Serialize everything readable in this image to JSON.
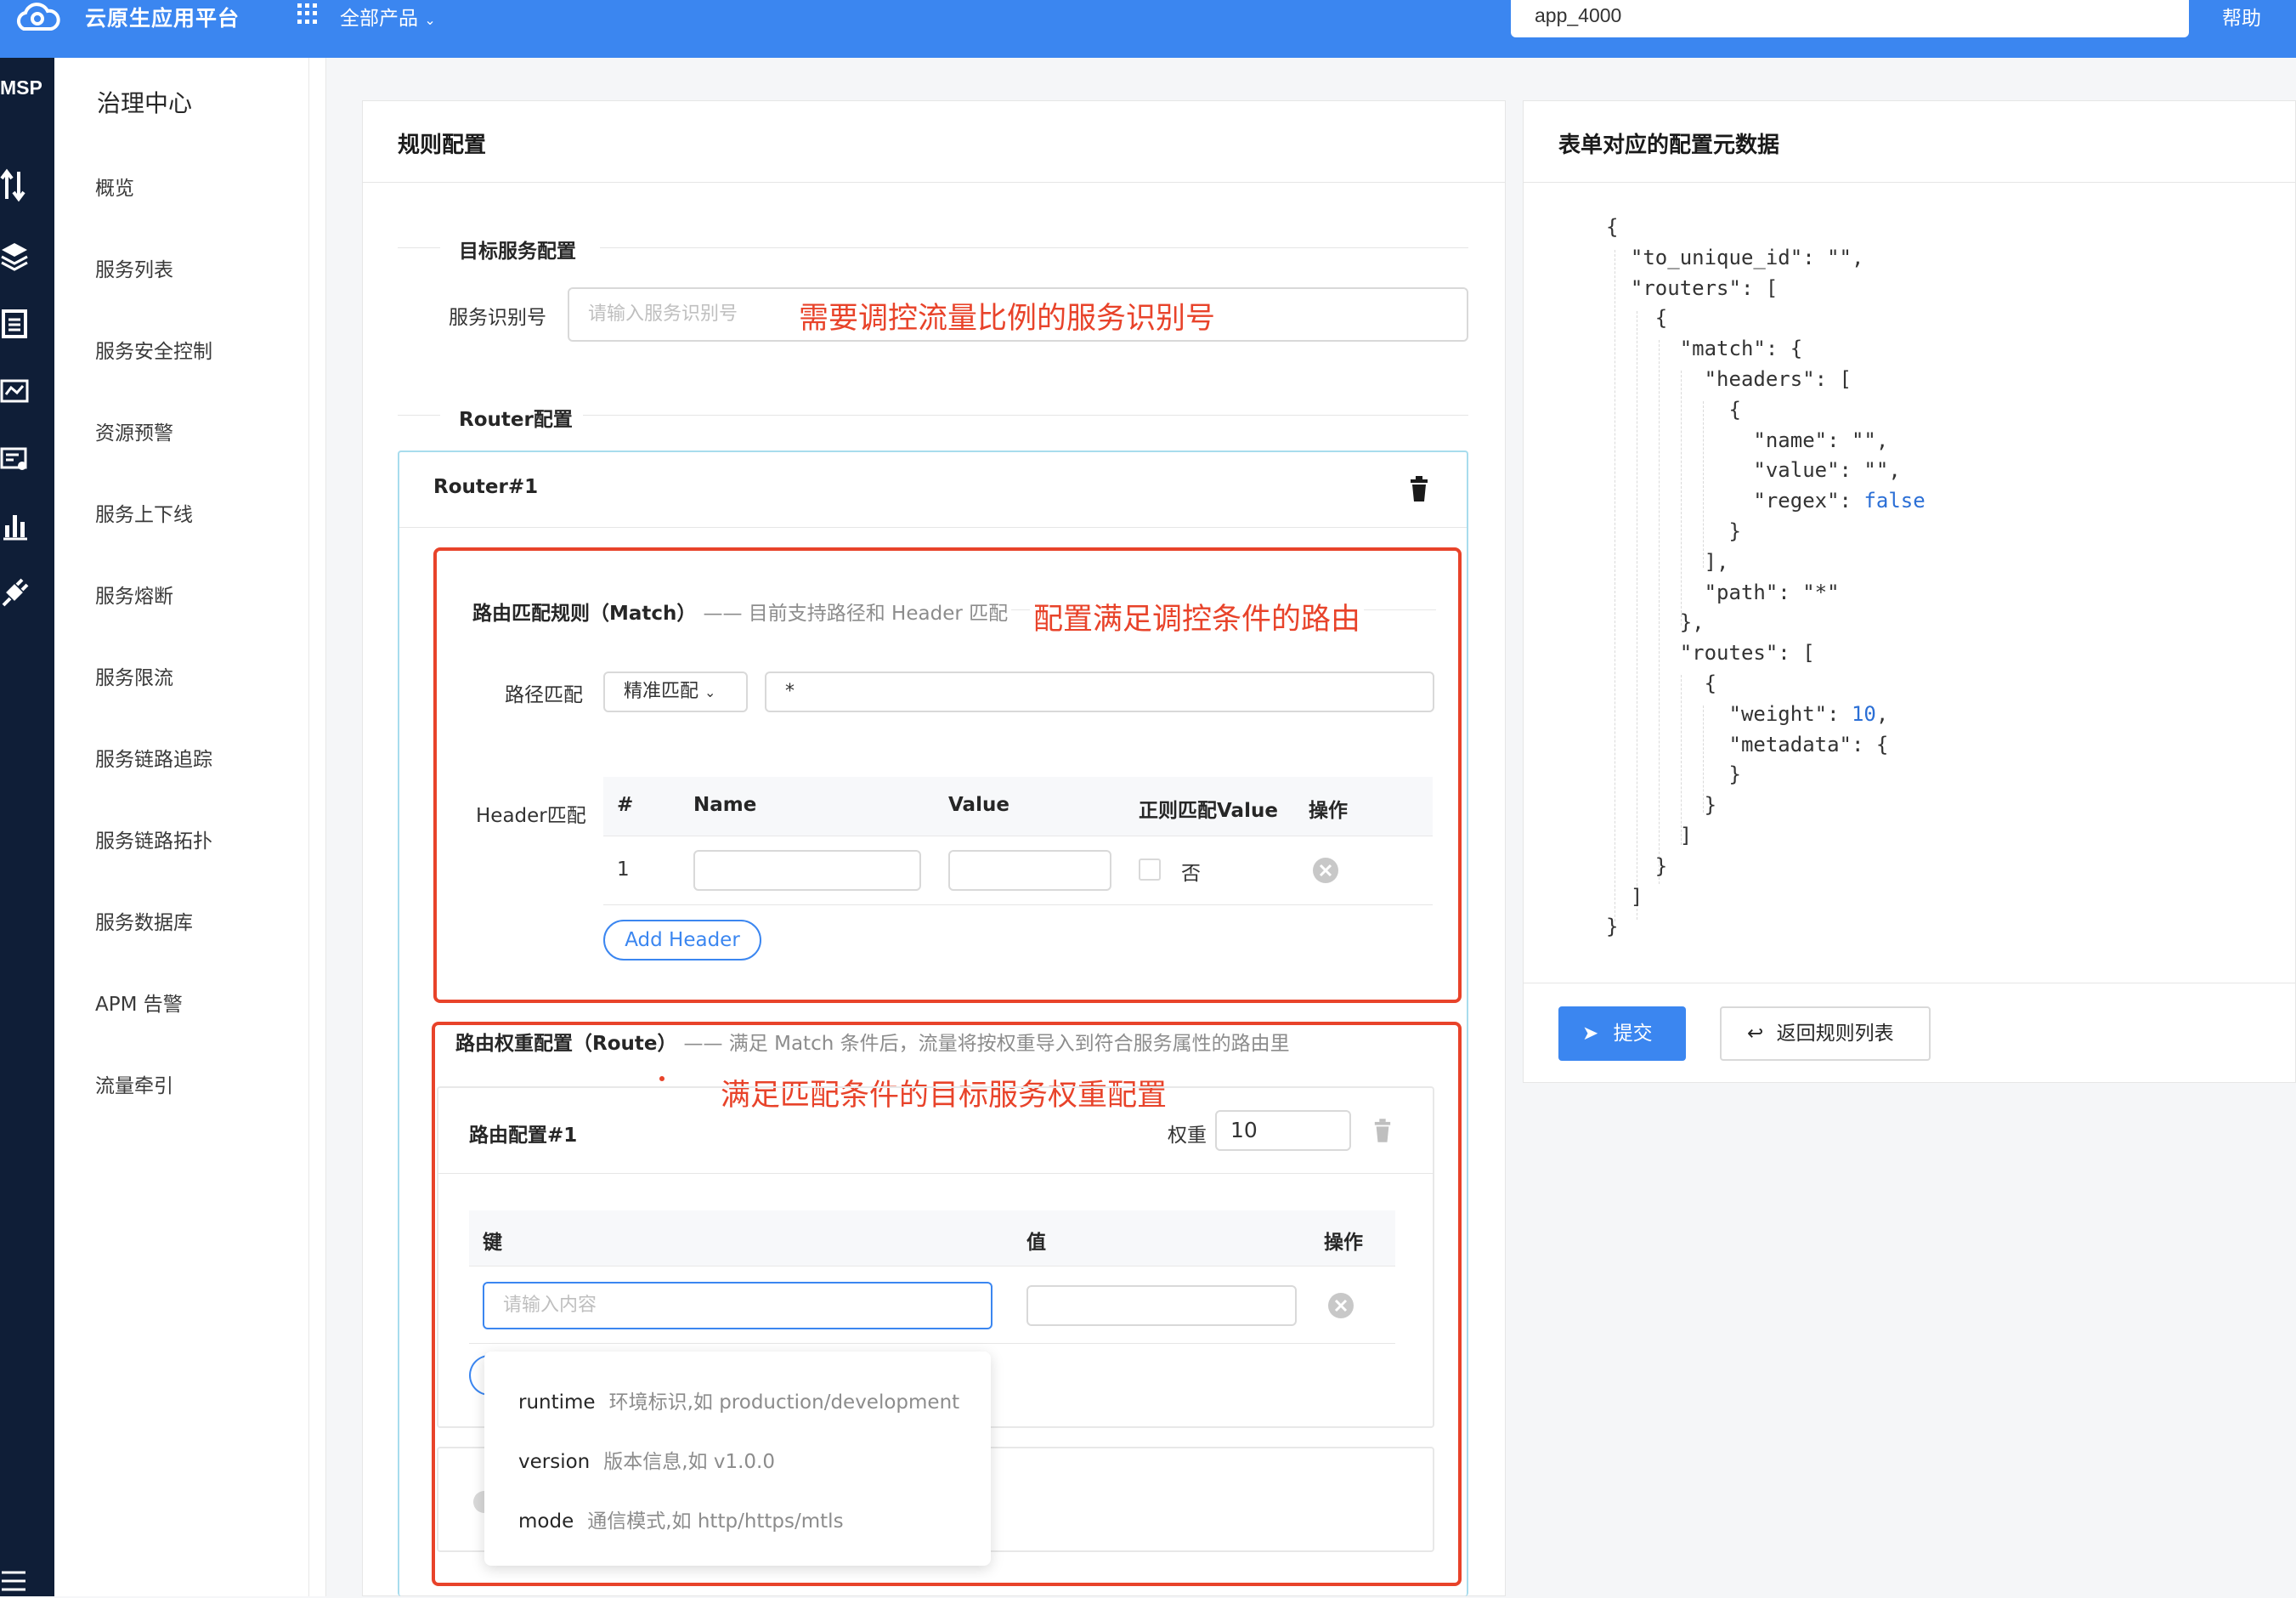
{
  "header": {
    "platform_name": "云原生应用平台",
    "products_label": "全部产品",
    "search_value": "app_4000",
    "help_label": "帮助"
  },
  "rail": {
    "product_abbr": "MSP"
  },
  "sidebar": {
    "title": "治理中心",
    "items": [
      "概览",
      "服务列表",
      "服务安全控制",
      "资源预警",
      "服务上下线",
      "服务熔断",
      "服务限流",
      "服务链路追踪",
      "服务链路拓扑",
      "服务数据库",
      "APM 告警",
      "流量牵引"
    ]
  },
  "rule_panel": {
    "title": "规则配置",
    "target_section": "目标服务配置",
    "service_id_label": "服务识别号",
    "service_id_placeholder": "请输入服务识别号",
    "service_id_note": "需要调控流量比例的服务识别号",
    "router_section": "Router配置",
    "router_title": "Router#1",
    "match": {
      "title": "路由匹配规则（Match）",
      "hint": "—— 目前支持路径和 Header 匹配",
      "note": "配置满足调控条件的路由",
      "path_label": "路径匹配",
      "path_mode": "精准匹配",
      "path_value": "*",
      "header_label": "Header匹配",
      "columns": [
        "#",
        "Name",
        "Value",
        "正则匹配Value",
        "操作"
      ],
      "row_index": "1",
      "regex_text": "否",
      "add_header": "Add Header"
    },
    "route": {
      "title": "路由权重配置（Route）",
      "hint": "—— 满足 Match 条件后，流量将按权重导入到符合服务属性的路由里",
      "note": "满足匹配条件的目标服务权重配置",
      "config_title": "路由配置#1",
      "weight_label": "权重",
      "weight_value": "10",
      "columns": [
        "键",
        "值",
        "操作"
      ],
      "key_placeholder": "请输入内容"
    },
    "dropdown": [
      {
        "key": "runtime",
        "desc": "环境标识,如 production/development"
      },
      {
        "key": "version",
        "desc": "版本信息,如 v1.0.0"
      },
      {
        "key": "mode",
        "desc": "通信模式,如 http/https/mtls"
      }
    ]
  },
  "meta_panel": {
    "title": "表单对应的配置元数据",
    "json_lines": [
      "{",
      "  \"to_unique_id\": \"\",",
      "  \"routers\": [",
      "    {",
      "      \"match\": {",
      "        \"headers\": [",
      "          {",
      "            \"name\": \"\",",
      "            \"value\": \"\",",
      "            \"regex\": false",
      "          }",
      "        ],",
      "        \"path\": \"*\"",
      "      },",
      "      \"routes\": [",
      "        {",
      "          \"weight\": 10,",
      "          \"metadata\": {",
      "          }",
      "        }",
      "      ]",
      "    }",
      "  ]",
      "}"
    ],
    "submit_label": "提交",
    "back_label": "返回规则列表"
  },
  "colors": {
    "primary": "#3b86f0",
    "annotation": "#e8432a",
    "rail": "#0f1e37"
  }
}
